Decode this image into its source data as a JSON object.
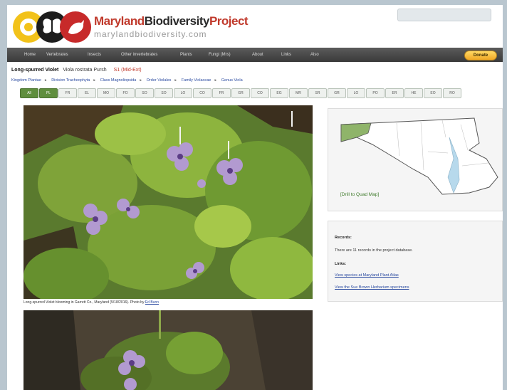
{
  "site": {
    "title_part1": "Maryland",
    "title_part2": "Biodiversity",
    "title_part3": "Project",
    "url": "marylandbiodiversity.com"
  },
  "nav": {
    "items": [
      "Home",
      "Vertebrates",
      "Insects",
      "Other invertebrates",
      "Plants",
      "Fungi (Mrs)",
      "About",
      "Links",
      "Also"
    ],
    "donate_label": "Donate"
  },
  "species": {
    "common_name": "Long-spurred Violet",
    "scientific_name": "Viola rostrata Pursh",
    "record_count": "S1 (Mid-Ext)"
  },
  "taxonomy": [
    "Kingdom Plantae",
    "Division Tracheophyta",
    "Class Magnoliopsida",
    "Order Violales",
    "Family Violaceae",
    "Genus Viola"
  ],
  "months": [
    "All",
    "PL",
    "FR",
    "EL",
    "MO",
    "FO",
    "SO",
    "SO",
    "LO",
    "CO",
    "FR",
    "GR",
    "CO",
    "EG",
    "MR",
    "SR",
    "GR",
    "LO",
    "PO",
    "ER",
    "HE",
    "EO",
    "RO"
  ],
  "photos": {
    "caption_text": "Long-spurred Violet blooming in Garrett Co., Maryland (5/18/2016). Photo by",
    "caption_author": "Ed Bunn"
  },
  "map": {
    "link_label": "[Drill to Quad Map]"
  },
  "info": {
    "records_heading": "Records:",
    "records_text": "There are 11 records in the project database.",
    "links_heading": "Links:",
    "link1": "View species at Maryland Plant Atlas",
    "link2": "View the Sue Brown Herbarium specimens"
  },
  "colors": {
    "brand_red": "#c0392b",
    "nav_bg": "#474747",
    "month_active": "#5f8e3d",
    "link_blue": "#2a4aa0",
    "map_land": "#ffffff",
    "map_water": "#b7d9ec",
    "map_highlight": "#8fb46a"
  }
}
